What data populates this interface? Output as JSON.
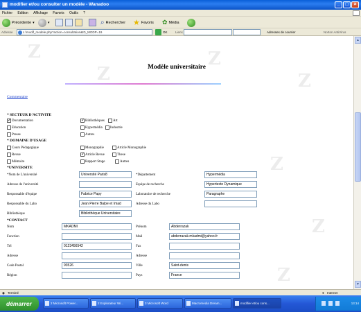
{
  "window": {
    "title": "modifier et/ou consulter un modèle - Wanadoo",
    "minimize": "_",
    "maximize": "□",
    "close": "×"
  },
  "menu": [
    "Fichier",
    "Edition",
    "Affichage",
    "Favoris",
    "Outils",
    "?"
  ],
  "toolbar": {
    "back": "Précédente",
    "search": "Rechercher",
    "favorites": "Favoris",
    "media": "Média"
  },
  "addressbar": {
    "label": "Adresse",
    "url": "L:\\modif_modele.php?action=consultation&ID_MODP=19",
    "go": "OK",
    "links_label": "Liens",
    "search_label": "Adresses de courrier",
    "antivirus": "Norton AntiVirus"
  },
  "page": {
    "title": "Modèle universitaire",
    "comment_link": "Commentaire",
    "watermark": "Z"
  },
  "secteur": {
    "heading": "* SECTEUR D'ACTIVITE",
    "options": [
      {
        "label": "Documentation",
        "checked": true
      },
      {
        "label": "Bibliothèques",
        "checked": true
      },
      {
        "label": "Art",
        "checked": false
      },
      {
        "label": "Education",
        "checked": false
      },
      {
        "label": "Hypermédia",
        "checked": false
      },
      {
        "label": "Industrie",
        "checked": false
      },
      {
        "label": "Presse",
        "checked": false
      },
      {
        "label": "Autres",
        "checked": false
      }
    ]
  },
  "domaine": {
    "heading": "* DOMAINE D'USAGE",
    "options": [
      {
        "label": "Cours Pédagogique",
        "checked": false
      },
      {
        "label": "Monographie",
        "checked": false
      },
      {
        "label": "Article Monographie",
        "checked": false
      },
      {
        "label": "Revue",
        "checked": false
      },
      {
        "label": "Article Revue",
        "checked": true
      },
      {
        "label": "These",
        "checked": false
      },
      {
        "label": "Mémoire",
        "checked": false
      },
      {
        "label": "Rapport Stage",
        "checked": false
      },
      {
        "label": "Autres",
        "checked": false
      }
    ]
  },
  "universite": {
    "heading": "*UNIVERSITE",
    "fields": {
      "nom_label": "*Nom de L'université",
      "nom_value": "Université Paris8",
      "departement_label": "*Département",
      "departement_value": "Hypermédia",
      "adresse_label": "Adresse de l'université",
      "adresse_value": "",
      "equipe_label": "Equipe de recherche",
      "equipe_value": "Hypertexte Dynamique",
      "resp_equipe_label": "Responsable d'équipe",
      "resp_equipe_value": "Fabrice Papy",
      "labo_label": "Laboratoire de recherche",
      "labo_value": "Paragraphe",
      "resp_labo_label": "Responsable du Labo",
      "resp_labo_value": "Jean Pierre Balpe et Imad",
      "adresse_labo_label": "Adresse du Labo",
      "adresse_labo_value": "",
      "biblio_label": "Bibliothèque",
      "biblio_value": "Bibliothèque Universitaire"
    }
  },
  "contact": {
    "heading": "*CONTACT",
    "fields": {
      "nom_label": "Nom",
      "nom_value": "MKADMI",
      "prenom_label": "Prénom",
      "prenom_value": "Abderrazak",
      "fonction_label": "Fonction",
      "fonction_value": "",
      "mail_label": "Mail",
      "mail_value": "abderrazak.mkadmi@yahoo.fr",
      "tel_label": "Tél",
      "tel_value": "0123456542",
      "fax_label": "Fax",
      "fax_value": "",
      "adresse_label": "Adresse",
      "adresse_value": "",
      "adresse2_label": "Adresse",
      "adresse2_value": "",
      "cp_label": "Code Postal",
      "cp_value": "93526",
      "ville_label": "Ville",
      "ville_value": "Saint-denis",
      "region_label": "Région",
      "region_value": "",
      "pays_label": "Pays",
      "pays_value": "France"
    }
  },
  "statusbar": {
    "left": "Terminé",
    "right": "Internet"
  },
  "taskbar": {
    "start": "démarrer",
    "tasks": [
      "2 Microsoft Power...",
      "2 Explorateur Wi...",
      "3 Microsoft Word",
      "Macromedia Dream...",
      "modifier et/ou cons..."
    ],
    "clock": "13:14"
  }
}
